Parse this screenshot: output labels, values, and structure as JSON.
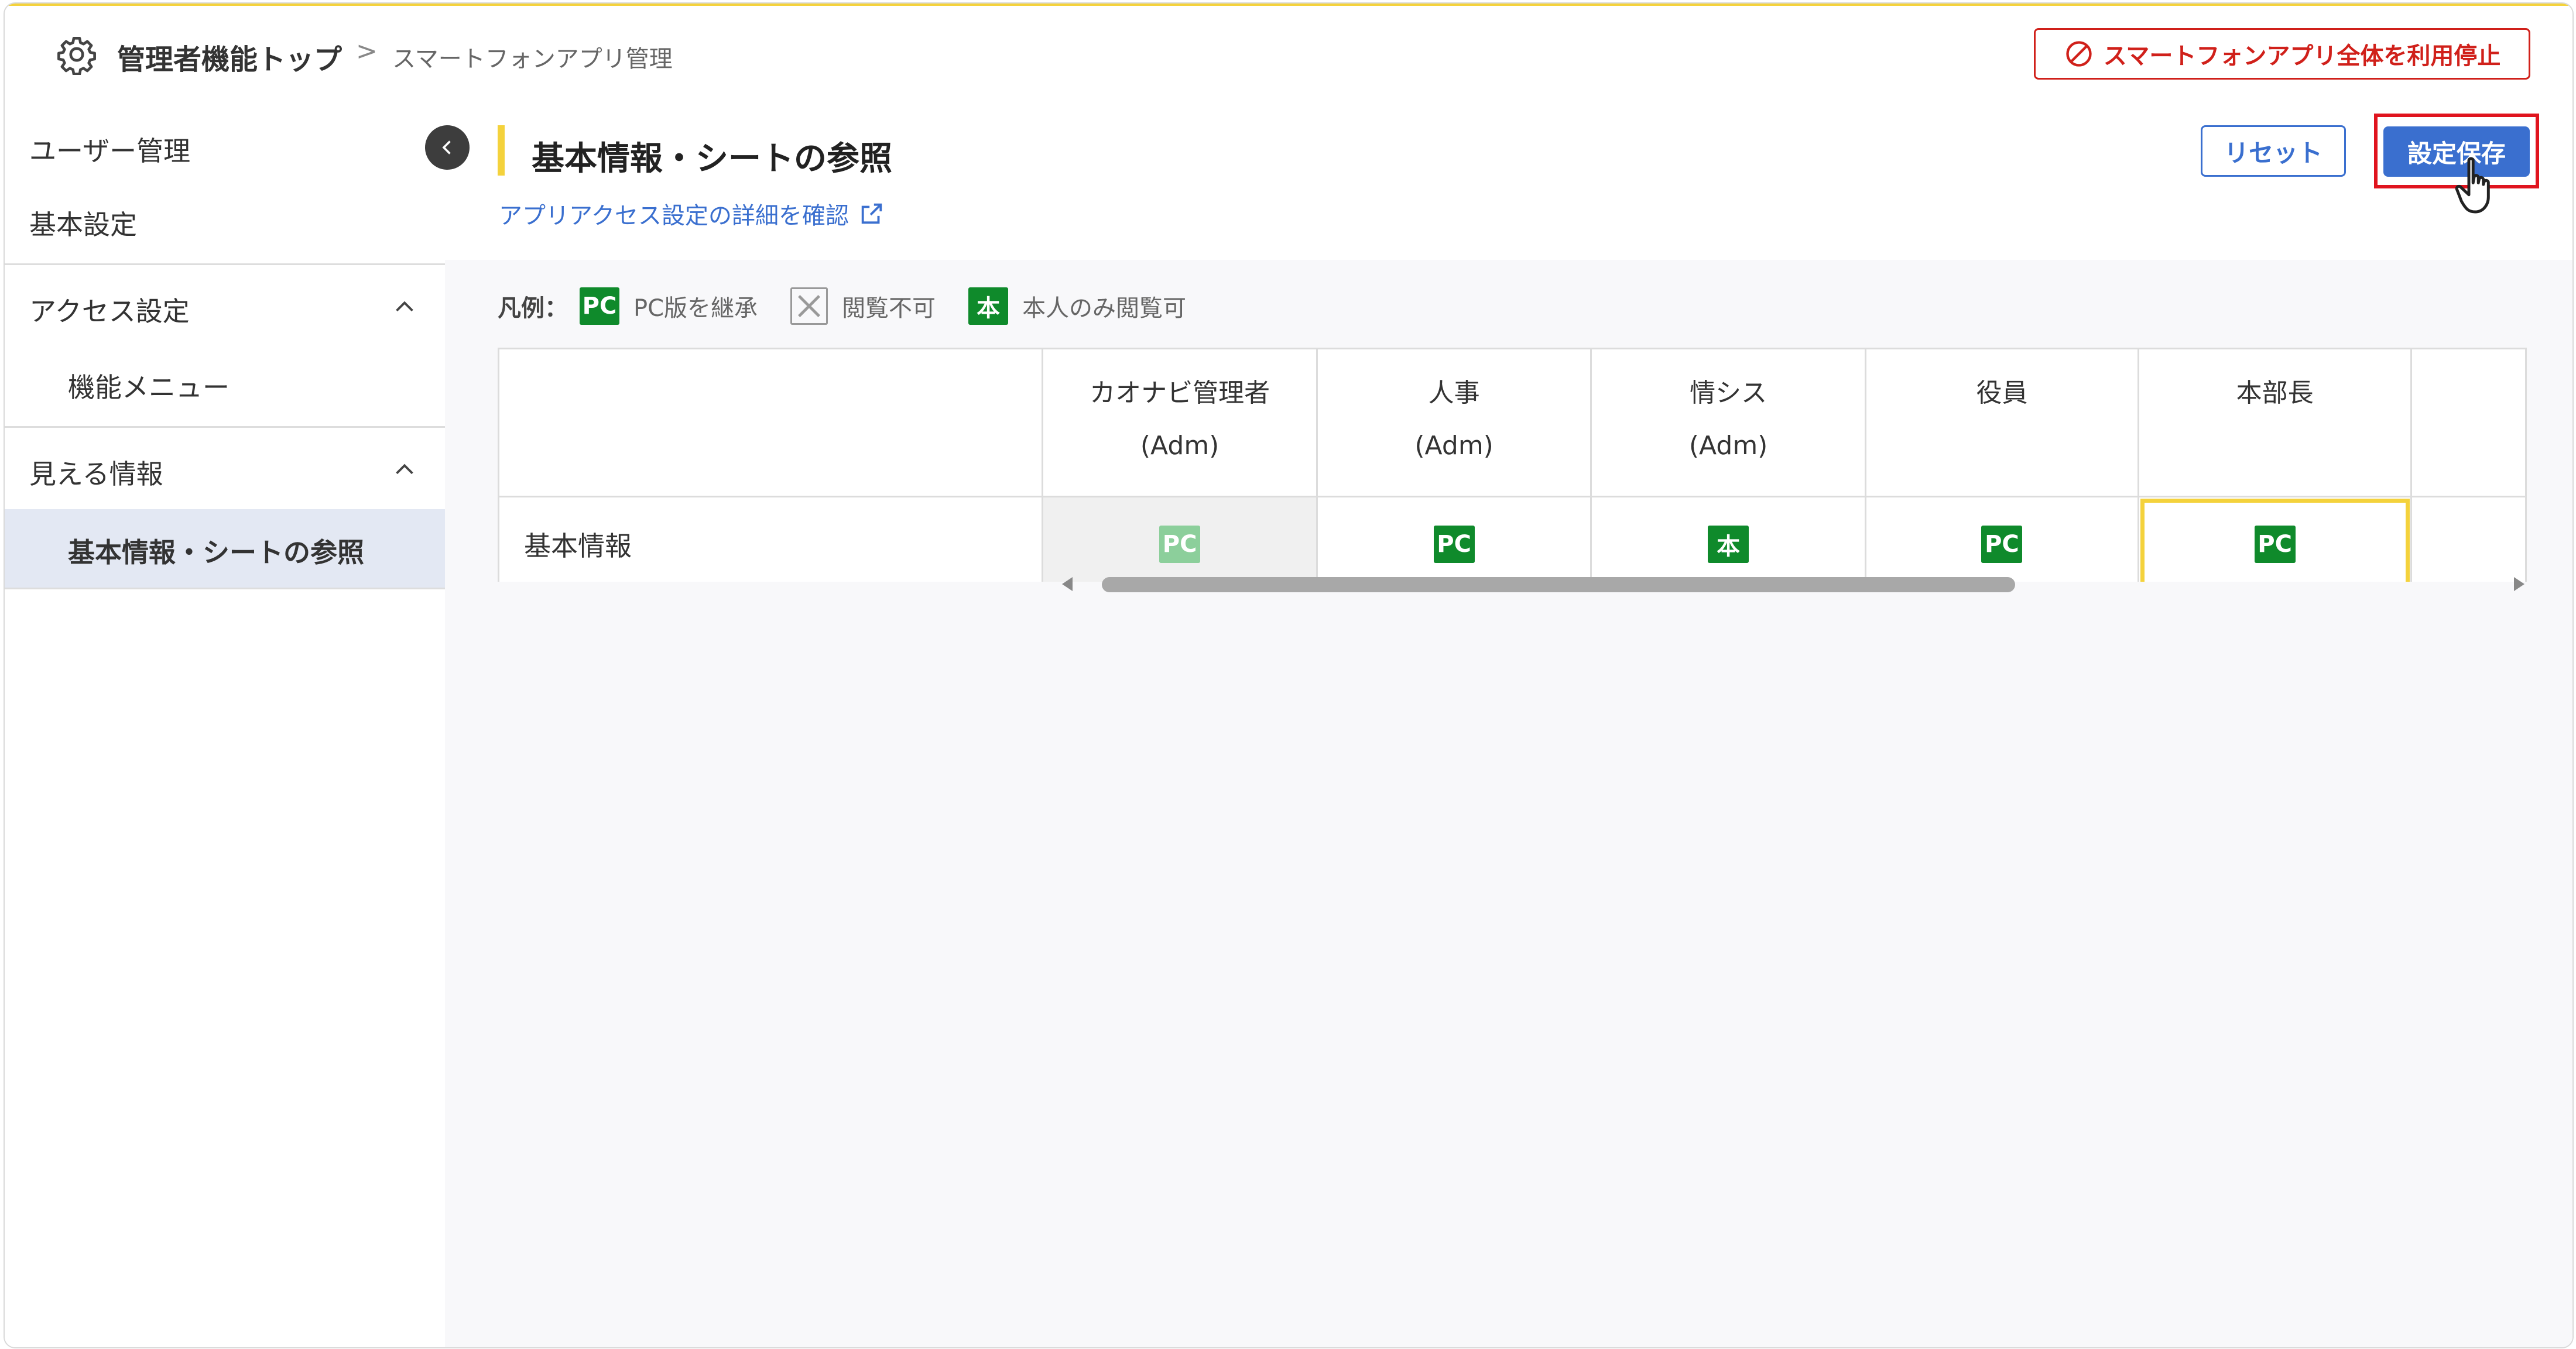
{
  "breadcrumb": {
    "home": "管理者機能トップ",
    "separator": ">",
    "current": "スマートフォンアプリ管理"
  },
  "header": {
    "stop_button": "スマートフォンアプリ全体を利用停止"
  },
  "sidebar": {
    "items": [
      {
        "label": "ユーザー管理"
      },
      {
        "label": "基本設定"
      }
    ],
    "groups": [
      {
        "label": "アクセス設定",
        "children": [
          {
            "label": "機能メニュー"
          }
        ]
      },
      {
        "label": "見える情報",
        "children": [
          {
            "label": "基本情報・シートの参照"
          }
        ]
      }
    ]
  },
  "main": {
    "title": "基本情報・シートの参照",
    "detail_link": "アプリアクセス設定の詳細を確認",
    "reset_button": "リセット",
    "save_button": "設定保存"
  },
  "legend": {
    "title": "凡例：",
    "items": [
      {
        "badge": "PC",
        "label": "PC版を継承"
      },
      {
        "badge": "×",
        "label": "閲覧不可"
      },
      {
        "badge": "本",
        "label": "本人のみ閲覧可"
      }
    ]
  },
  "table": {
    "columns": [
      {
        "line1": "カオナビ管理者",
        "line2": "(Adm)"
      },
      {
        "line1": "人事",
        "line2": "(Adm)"
      },
      {
        "line1": "情シス",
        "line2": "(Adm)"
      },
      {
        "line1": "役員",
        "line2": ""
      },
      {
        "line1": "本部長",
        "line2": ""
      }
    ],
    "rows": [
      {
        "label": "基本情報",
        "cells": [
          "PC",
          "PC",
          "本",
          "PC",
          "PC"
        ]
      }
    ]
  },
  "colors": {
    "accent_yellow": "#f4d23c",
    "primary_blue": "#3a6fcf",
    "danger_red": "#d0201a",
    "badge_green": "#0f8a2b"
  }
}
